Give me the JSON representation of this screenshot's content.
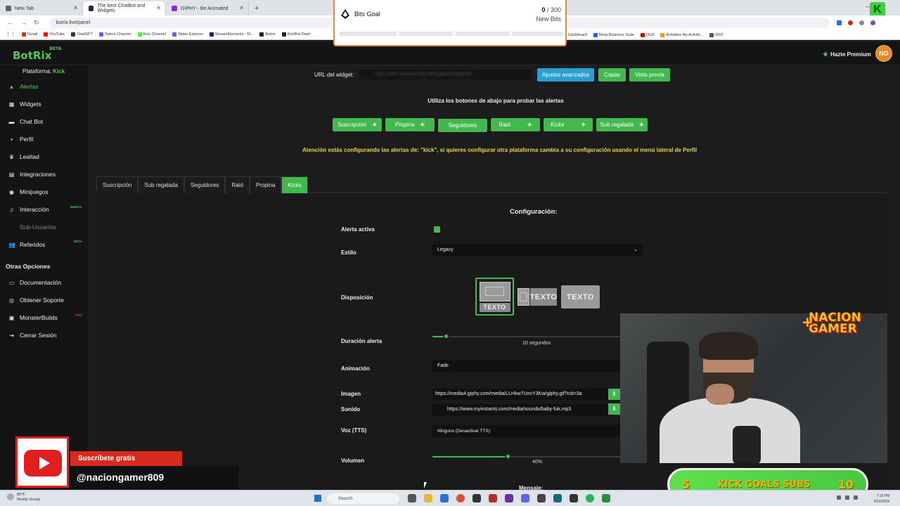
{
  "browser": {
    "tabs": [
      {
        "label": "New Tab",
        "color": "#5f6368"
      },
      {
        "label": "The best ChatBot and Widgets",
        "color": "#2a2a2a"
      },
      {
        "label": "GIPHY - Be Animated",
        "color": "#8a2be2"
      }
    ],
    "new_tab": "+",
    "url": "botrix.live/panel",
    "bookmarks": [
      "Gmail",
      "YouTube",
      "ChatGPT",
      "Twitch Channel",
      "Kick Channel",
      "Stripe Express",
      "StreamElements - M...",
      "Botrix",
      "KickBot Dash"
    ],
    "bookmarks_right": [
      "Dashboard",
      "Meta Business Suite",
      "DGII",
      "Activities My Activiti...",
      "VDO"
    ]
  },
  "goal": {
    "title": "Bits Goal",
    "current": "0",
    "total": "/ 300",
    "unit": "New Bits",
    "progress": 0
  },
  "app": {
    "logo": "BotRix",
    "logo_badge": "BETA",
    "premium": "Hazte Premium",
    "avatar": "NG"
  },
  "sidebar": {
    "platform_label": "Plataforma:",
    "platform_value": "Kick",
    "items": [
      {
        "label": "Alertas",
        "icon": "bell-icon"
      },
      {
        "label": "Widgets",
        "icon": "widgets-icon"
      },
      {
        "label": "Chat Bot",
        "icon": "chat-icon"
      },
      {
        "label": "Perfil",
        "icon": "profile-icon"
      },
      {
        "label": "Lealtad",
        "icon": "trophy-icon"
      },
      {
        "label": "Integraciones",
        "icon": "integrations-icon"
      },
      {
        "label": "Minijuegos",
        "icon": "gamepad-icon"
      },
      {
        "label": "Interacción",
        "icon": "music-icon",
        "badge": "NUEVO"
      },
      {
        "label": "Sub-Usuarios",
        "icon": "users-icon"
      },
      {
        "label": "Referidos",
        "icon": "referrals-icon",
        "badge": "BETA"
      }
    ],
    "section_title": "Otras Opciones",
    "other_items": [
      {
        "label": "Documentación",
        "icon": "doc-icon"
      },
      {
        "label": "Obtener Soporte",
        "icon": "support-icon"
      },
      {
        "label": "MonsterBuilds",
        "icon": "monitor-icon",
        "badge": "PRO"
      },
      {
        "label": "Cerrar Sesión",
        "icon": "logout-icon"
      }
    ]
  },
  "widget": {
    "url_label": "URL del widget:",
    "url_value": "https://botrix.live/alerts?bid=4f9k2gaBxduPQpqmRz",
    "btn_advanced": "Ajustes avanzados",
    "btn_copy": "Copiar",
    "btn_preview": "Vista previa",
    "test_hint": "Utiliza los botones de abajo para probar las alertas",
    "test_buttons": [
      "Suscripción",
      "Propina",
      "Seguidores",
      "Raid",
      "Kicks",
      "Sub regalada"
    ],
    "warning": "Atención estás configurando las alertas de: \"kick\", si quieres configurar otra plataforma cambia a su configuración usando el menú lateral de Perfil"
  },
  "tabs": [
    "Suscripción",
    "Sub regalada",
    "Seguidores",
    "Raid",
    "Propina",
    "Kicks"
  ],
  "config": {
    "title": "Configuración:",
    "alerta_activa": "Alerta activa",
    "estilo_label": "Estilo",
    "estilo_value": "Legacy",
    "disposicion_label": "Disposición",
    "layout_text": "TEXTO",
    "duracion_label": "Duración alerta",
    "duracion_value": "10 segundos",
    "duracion_level": 0.07,
    "animacion_label": "Animación",
    "animacion_value": "Fade",
    "imagen_label": "Imagen",
    "imagen_value": "https://media4.giphy.com/media/LLHkw7UnvY3Kw/giphy.gif?cid=3a",
    "sonido_label": "Sonido",
    "sonido_value": "https://www.myinstants.com/media/sounds/baby-fuk.mp3",
    "voz_label": "Voz (TTS)",
    "voz_value": "Ninguno (Desactivar TTS)",
    "volumen_label": "Volumen",
    "volumen_value": "40%",
    "volumen_level": 0.4,
    "mensaje_label": "Mensaje:"
  },
  "stream": {
    "brand_line1": "NACION",
    "brand_line2": "GAMER",
    "kick_left": "5",
    "kick_mid": "KICK GOALS SUBS",
    "kick_right": "10",
    "subscribe": "Suscríbete gratis",
    "handle": "@naciongamer809"
  },
  "taskbar": {
    "weather_temp": "80°F",
    "weather_desc": "Mostly cloudy",
    "search": "Search",
    "time": "7:15 PM",
    "date": "9/16/2025"
  }
}
